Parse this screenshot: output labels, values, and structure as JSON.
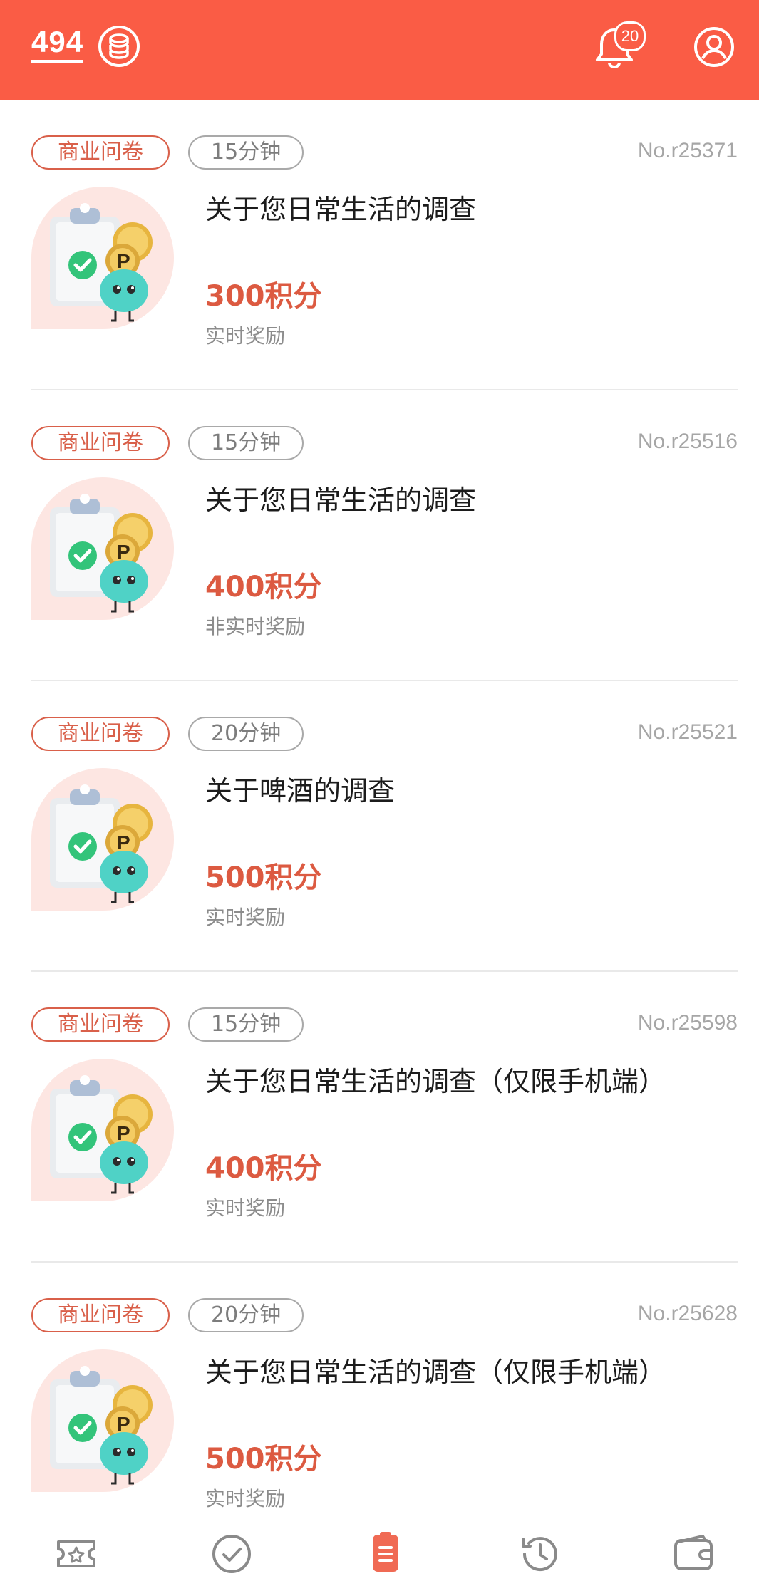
{
  "header": {
    "points": "494",
    "notification_count": "20",
    "icons": {
      "coin": "coin-stack-icon",
      "bell": "bell-icon",
      "profile": "user-profile-icon"
    }
  },
  "colors": {
    "header_bg": "#fa5c45",
    "tag_type": "#d9604a",
    "reward": "#dc5a41",
    "nav_active": "#f06a54",
    "nav_inactive": "#8a8a8a"
  },
  "surveys": [
    {
      "tag": "商业问卷",
      "duration": "15分钟",
      "no": "No.r25371",
      "title": "关于您日常生活的调查",
      "reward": "300积分",
      "reward_type": "实时奖励"
    },
    {
      "tag": "商业问卷",
      "duration": "15分钟",
      "no": "No.r25516",
      "title": "关于您日常生活的调查",
      "reward": "400积分",
      "reward_type": "非实时奖励"
    },
    {
      "tag": "商业问卷",
      "duration": "20分钟",
      "no": "No.r25521",
      "title": "关于啤酒的调查",
      "reward": "500积分",
      "reward_type": "实时奖励"
    },
    {
      "tag": "商业问卷",
      "duration": "15分钟",
      "no": "No.r25598",
      "title": "关于您日常生活的调查（仅限手机端）",
      "reward": "400积分",
      "reward_type": "实时奖励"
    },
    {
      "tag": "商业问卷",
      "duration": "20分钟",
      "no": "No.r25628",
      "title": "关于您日常生活的调查（仅限手机端）",
      "reward": "500积分",
      "reward_type": "实时奖励"
    }
  ],
  "bottom_nav": [
    {
      "icon": "ticket-star-icon",
      "active": false
    },
    {
      "icon": "check-circle-icon",
      "active": false
    },
    {
      "icon": "survey-list-icon",
      "active": true
    },
    {
      "icon": "history-icon",
      "active": false
    },
    {
      "icon": "wallet-icon",
      "active": false
    }
  ]
}
